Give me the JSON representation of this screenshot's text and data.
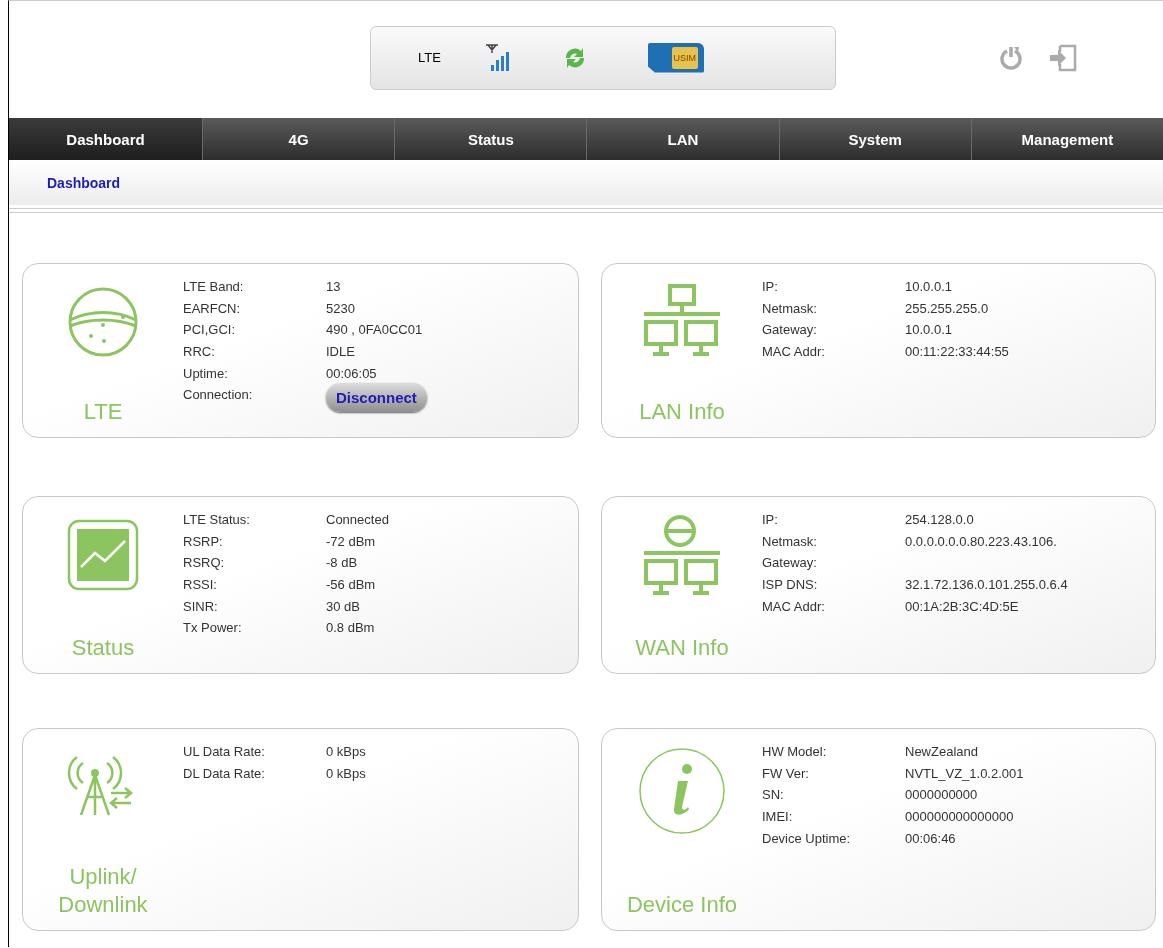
{
  "header": {
    "network": "LTE",
    "sim_label": "USIM"
  },
  "tabs": [
    {
      "label": "Dashboard",
      "selected": true
    },
    {
      "label": "4G",
      "selected": false
    },
    {
      "label": "Status",
      "selected": false
    },
    {
      "label": "LAN",
      "selected": false
    },
    {
      "label": "System",
      "selected": false
    },
    {
      "label": "Management",
      "selected": false
    }
  ],
  "breadcrumb": "Dashboard",
  "cards": [
    {
      "kind": "globe",
      "title": "LTE",
      "rows": [
        {
          "label": "LTE Band:",
          "value": "13"
        },
        {
          "label": "EARFCN:",
          "value": "5230"
        },
        {
          "label": "PCI,GCI:",
          "value": "490 , 0FA0CC01"
        },
        {
          "label": "RRC:",
          "value": "IDLE"
        },
        {
          "label": "Uptime:",
          "value": "00:06:05"
        },
        {
          "label": "Connection:",
          "value": "Disconnect",
          "kind": "button"
        }
      ]
    },
    {
      "kind": "lan",
      "title": "LAN Info",
      "rows": [
        {
          "label": "IP:",
          "value": "10.0.0.1"
        },
        {
          "label": "Netmask:",
          "value": "255.255.255.0"
        },
        {
          "label": "Gateway:",
          "value": "10.0.0.1"
        },
        {
          "label": "MAC Addr:",
          "value": "00:11:22:33:44:55"
        }
      ]
    },
    {
      "kind": "chart",
      "title": "Status",
      "rows": [
        {
          "label": "LTE Status:",
          "value": "Connected"
        },
        {
          "label": "RSRP:",
          "value": "-72 dBm"
        },
        {
          "label": "RSRQ:",
          "value": "-8 dB"
        },
        {
          "label": "RSSI:",
          "value": "-56 dBm"
        },
        {
          "label": "SINR:",
          "value": "30 dB"
        },
        {
          "label": "Tx Power:",
          "value": "0.8 dBm"
        }
      ]
    },
    {
      "kind": "wan",
      "title": "WAN Info",
      "rows": [
        {
          "label": "IP:",
          "value": "254.128.0.0"
        },
        {
          "label": "Netmask:",
          "value": "0.0.0.0.0.0.80.223.43.106."
        },
        {
          "label": "Gateway:"
        },
        {
          "label": "ISP DNS:",
          "value": "32.1.72.136.0.101.255.0.6.4"
        },
        {
          "label": "MAC Addr:",
          "value": "00:1A:2B:3C:4D:5E"
        }
      ]
    },
    {
      "kind": "tower",
      "title": "Uplink/ Downlink",
      "rows": [
        {
          "label": "UL Data Rate:",
          "value": "0 kBps"
        },
        {
          "label": "DL Data Rate:",
          "value": "0 kBps"
        }
      ]
    },
    {
      "kind": "info",
      "title": "Device Info",
      "rows": [
        {
          "label": "HW Model:",
          "value": "NewZealand"
        },
        {
          "label": "FW Ver:",
          "value": "NVTL_VZ_1.0.2.001"
        },
        {
          "label": "SN:",
          "value": "0000000000"
        },
        {
          "label": "IMEI:",
          "value": "000000000000000"
        },
        {
          "label": "Device Uptime:",
          "value": "00:06:46"
        }
      ]
    }
  ]
}
